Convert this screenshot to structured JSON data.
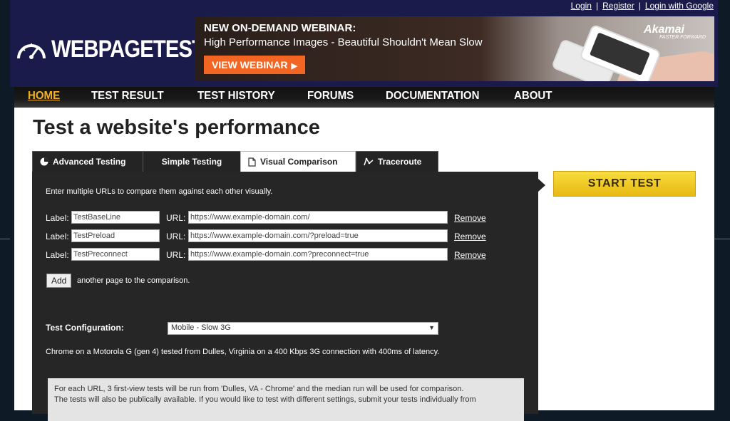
{
  "top_links": [
    "Login",
    "Register",
    "Login with Google"
  ],
  "logo": {
    "text": "WEBPAGETEST",
    "icon": "speedometer-icon"
  },
  "banner": {
    "title": "NEW ON-DEMAND WEBINAR:",
    "subtitle": "High Performance Images - Beautiful Shouldn't Mean Slow",
    "button": "VIEW WEBINAR",
    "brand": "Akamai",
    "brand_tag": "FASTER FORWARD",
    "button_color": "#f26522"
  },
  "nav": [
    "HOME",
    "TEST RESULT",
    "TEST HISTORY",
    "FORUMS",
    "DOCUMENTATION",
    "ABOUT"
  ],
  "page_title": "Test a website's performance",
  "tabs": [
    {
      "label": "Advanced Testing",
      "icon": "gauge-icon"
    },
    {
      "label": "Simple Testing",
      "icon": ""
    },
    {
      "label": "Visual Comparison",
      "icon": "document-icon"
    },
    {
      "label": "Traceroute",
      "icon": "traceroute-icon"
    }
  ],
  "intro": "Enter multiple URLs to compare them against each other visually.",
  "field_labels": {
    "label": "Label:",
    "url": "URL:",
    "remove": "Remove"
  },
  "rows": [
    {
      "label": "TestBaseLine",
      "url": "https://www.example-domain.com/"
    },
    {
      "label": "TestPreload",
      "url": "https://www.example-domain.com/?preload=true"
    },
    {
      "label": "TestPreconnect",
      "url": "https://www.example-domain.com?preconnect=true"
    }
  ],
  "add": {
    "button": "Add",
    "text": "another page to the comparison."
  },
  "config": {
    "label": "Test Configuration:",
    "selected": "Mobile - Slow 3G",
    "description": "Chrome on a Motorola G (gen 4) tested from Dulles, Virginia on a 400 Kbps 3G connection with 400ms of latency."
  },
  "note": {
    "line1": "For each URL, 3 first-view tests will be run from 'Dulles, VA - Chrome' and the median run will be used for comparison.",
    "line2": "The tests will also be publically available. If you would like to test with different settings, submit your tests individually from"
  },
  "start_button": "START TEST",
  "colors": {
    "header_bg": "#1b1b4b",
    "nav_active": "#f4b21a",
    "panel_bg": "#262626",
    "start": "#f2cc2a"
  }
}
